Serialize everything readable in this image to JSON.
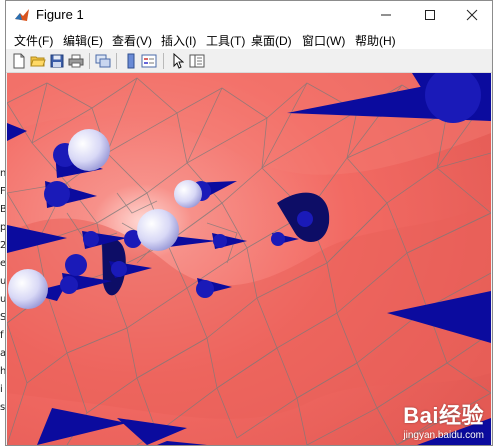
{
  "window": {
    "title": "Figure 1"
  },
  "menus": [
    {
      "label": "文件(F)"
    },
    {
      "label": "编辑(E)"
    },
    {
      "label": "查看(V)"
    },
    {
      "label": "插入(I)"
    },
    {
      "label": "工具(T)"
    },
    {
      "label": "桌面(D)"
    },
    {
      "label": "窗口(W)"
    },
    {
      "label": "帮助(H)"
    }
  ],
  "toolbar": [
    "new-file-icon",
    "open-folder-icon",
    "save-icon",
    "print-icon",
    "link-plot-icon",
    "colorbar-icon",
    "legend-icon",
    "pointer-icon",
    "property-editor-icon"
  ],
  "side_text": [
    "n",
    "F",
    "B",
    "p",
    "2",
    "e",
    "u",
    "u",
    "S",
    "f",
    "a",
    "h",
    "i",
    "s"
  ],
  "colors": {
    "surface": "#f26a63",
    "edges": "#7a7a7a",
    "cones": "#0b0b9e",
    "spheres": "#e8e8ff"
  },
  "watermark": {
    "brand": "Bai经验",
    "url": "jingyan.baidu.com"
  }
}
